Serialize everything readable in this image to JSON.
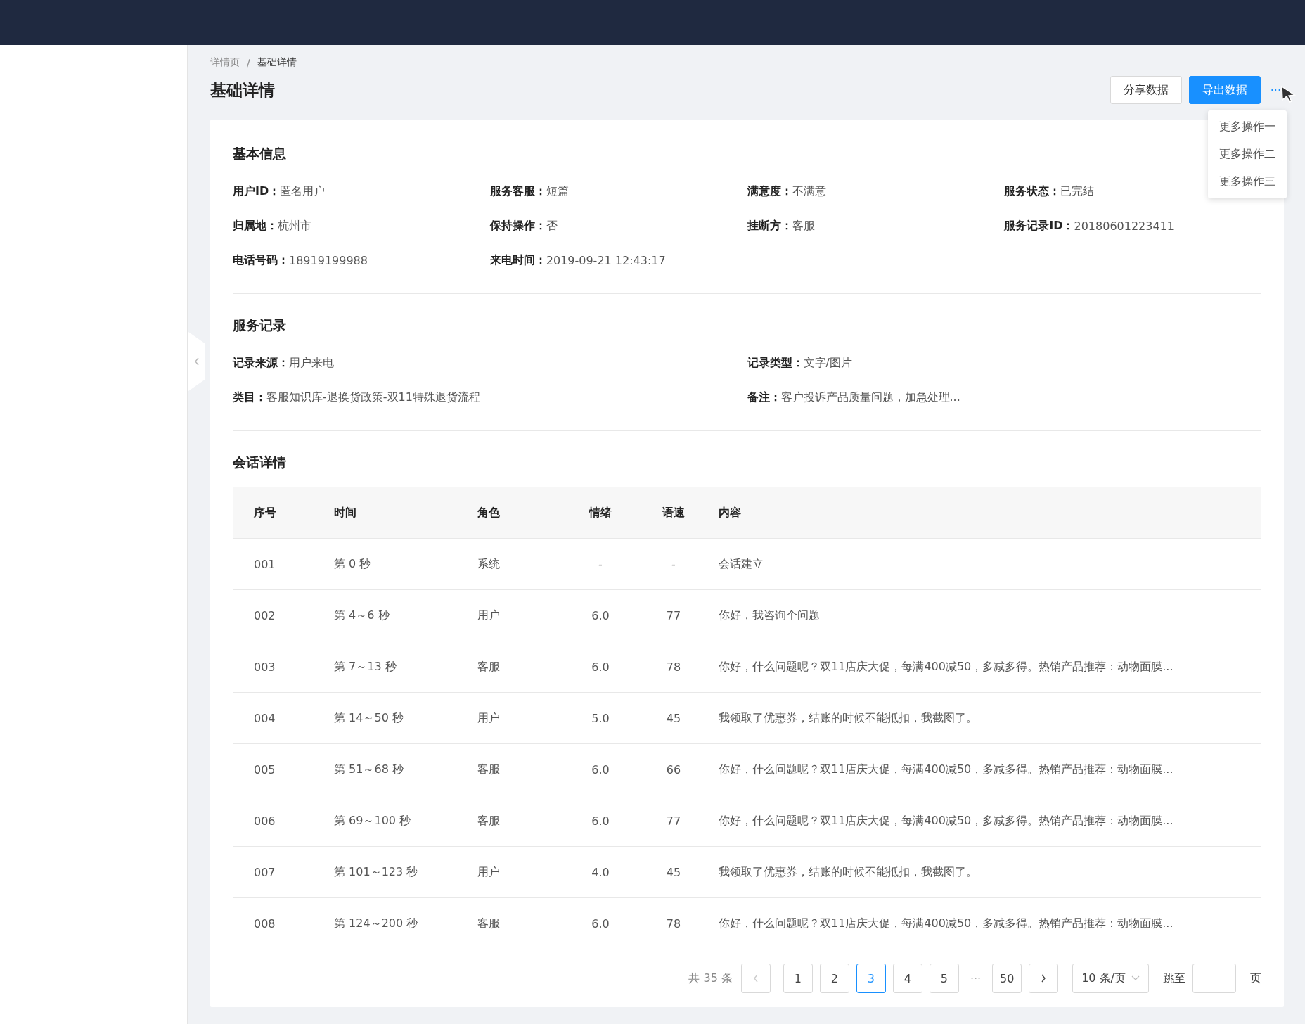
{
  "breadcrumb": [
    {
      "label": "详情页",
      "current": false
    },
    {
      "label": "基础详情",
      "current": true
    }
  ],
  "breadcrumb_separator": "/",
  "page_title": "基础详情",
  "actions": [
    {
      "label": "分享数据",
      "kind": "default"
    },
    {
      "label": "导出数据",
      "kind": "primary"
    }
  ],
  "more_button": "···",
  "more_menu": [
    "更多操作一",
    "更多操作二",
    "更多操作三"
  ],
  "basic_info": {
    "title": "基本信息",
    "fields": [
      {
        "label": "用户ID：",
        "value": "匿名用户"
      },
      {
        "label": "服务客服：",
        "value": "短篇"
      },
      {
        "label": "满意度：",
        "value": "不满意"
      },
      {
        "label": "服务状态：",
        "value": "已完结"
      },
      {
        "label": "归属地：",
        "value": "杭州市"
      },
      {
        "label": "保持操作：",
        "value": "否"
      },
      {
        "label": "挂断方：",
        "value": "客服"
      },
      {
        "label": "服务记录ID：",
        "value": "20180601223411"
      },
      {
        "label": "电话号码：",
        "value": "18919199988"
      },
      {
        "label": "来电时间：",
        "value": "2019-09-21 12:43:17"
      }
    ]
  },
  "service_record": {
    "title": "服务记录",
    "fields": [
      {
        "label": "记录来源：",
        "value": "用户来电"
      },
      {
        "label": "记录类型：",
        "value": "文字/图片"
      },
      {
        "label": "类目：",
        "value": "客服知识库-退换货政策-双11特殊退货流程"
      },
      {
        "label": "备注：",
        "value": "客户投诉产品质量问题，加急处理..."
      }
    ]
  },
  "conversation": {
    "title": "会话详情",
    "table": {
      "columns": [
        "序号",
        "时间",
        "角色",
        "情绪",
        "语速",
        "内容"
      ],
      "rows": [
        [
          "001",
          "第 0 秒",
          "系统",
          "-",
          "-",
          "会话建立"
        ],
        [
          "002",
          "第 4～6 秒",
          "用户",
          "6.0",
          "77",
          "你好，我咨询个问题"
        ],
        [
          "003",
          "第 7～13 秒",
          "客服",
          "6.0",
          "78",
          "你好，什么问题呢？双11店庆大促，每满400减50，多减多得。热销产品推荐：动物面膜..."
        ],
        [
          "004",
          "第 14～50 秒",
          "用户",
          "5.0",
          "45",
          "我领取了优惠券，结账的时候不能抵扣，我截图了。"
        ],
        [
          "005",
          "第 51～68 秒",
          "客服",
          "6.0",
          "66",
          "你好，什么问题呢？双11店庆大促，每满400减50，多减多得。热销产品推荐：动物面膜..."
        ],
        [
          "006",
          "第 69～100 秒",
          "客服",
          "6.0",
          "77",
          "你好，什么问题呢？双11店庆大促，每满400减50，多减多得。热销产品推荐：动物面膜..."
        ],
        [
          "007",
          "第 101～123 秒",
          "用户",
          "4.0",
          "45",
          "我领取了优惠券，结账的时候不能抵扣，我截图了。"
        ],
        [
          "008",
          "第 124～200 秒",
          "客服",
          "6.0",
          "78",
          "你好，什么问题呢？双11店庆大促，每满400减50，多减多得。热销产品推荐：动物面膜..."
        ]
      ]
    },
    "pagination": {
      "total": "共 35 条",
      "pages": [
        {
          "label": "1",
          "kind": "page",
          "selected": false
        },
        {
          "label": "2",
          "kind": "page",
          "selected": false
        },
        {
          "label": "3",
          "kind": "page",
          "selected": true
        },
        {
          "label": "4",
          "kind": "page",
          "selected": false
        },
        {
          "label": "5",
          "kind": "page",
          "selected": false
        },
        {
          "label": "···",
          "kind": "ellipsis",
          "selected": false
        },
        {
          "label": "50",
          "kind": "page",
          "selected": false
        }
      ],
      "prev_disabled": true,
      "next_disabled": false,
      "page_size": "10 条/页",
      "jump_label": "跳至",
      "jump_suffix": "页"
    }
  }
}
